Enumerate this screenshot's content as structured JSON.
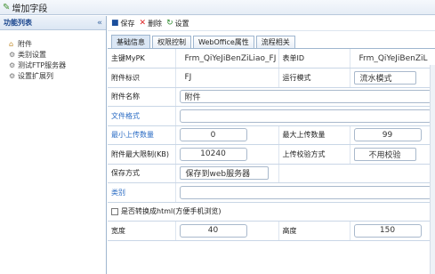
{
  "window": {
    "title": "增加字段"
  },
  "left_panel": {
    "header": "功能列表",
    "collapse_glyph": "«",
    "items": [
      {
        "label": "附件",
        "icon": "home-icon"
      },
      {
        "label": "类别设置",
        "icon": "gear-icon"
      },
      {
        "label": "测试FTP服务器",
        "icon": "gear-icon"
      },
      {
        "label": "设置扩展列",
        "icon": "gear-icon"
      }
    ]
  },
  "toolbar": {
    "save_label": "保存",
    "delete_label": "删除",
    "settings_label": "设置"
  },
  "tabs": [
    "基础信息",
    "权限控制",
    "WebOffice属性",
    "流程相关"
  ],
  "form": {
    "row1": {
      "label1": "主键MyPK",
      "value1": "Frm_QiYeJiBenZiLiao_FJ",
      "label2": "表单ID",
      "value2": "Frm_QiYeJiBenZiL"
    },
    "row2": {
      "label1": "附件标识",
      "value1": "FJ",
      "label2": "运行模式",
      "value2": "流水模式"
    },
    "row3": {
      "label": "附件名称",
      "value": "附件"
    },
    "row4": {
      "label": "文件格式",
      "value": ""
    },
    "row5": {
      "label1": "最小上传数量",
      "value1": "0",
      "label2": "最大上传数量",
      "value2": "99"
    },
    "row6": {
      "label1": "附件最大限制(KB)",
      "value1": "10240",
      "label2": "上传校验方式",
      "value2": "不用校验"
    },
    "row7": {
      "label": "保存方式",
      "value": "保存到web服务器"
    },
    "row8": {
      "label": "类别",
      "value": ""
    },
    "row9": {
      "label": "是否转换成html(方便手机浏览)"
    },
    "row10": {
      "label1": "宽度",
      "value1": "40",
      "label2": "高度",
      "value2": "150"
    }
  }
}
